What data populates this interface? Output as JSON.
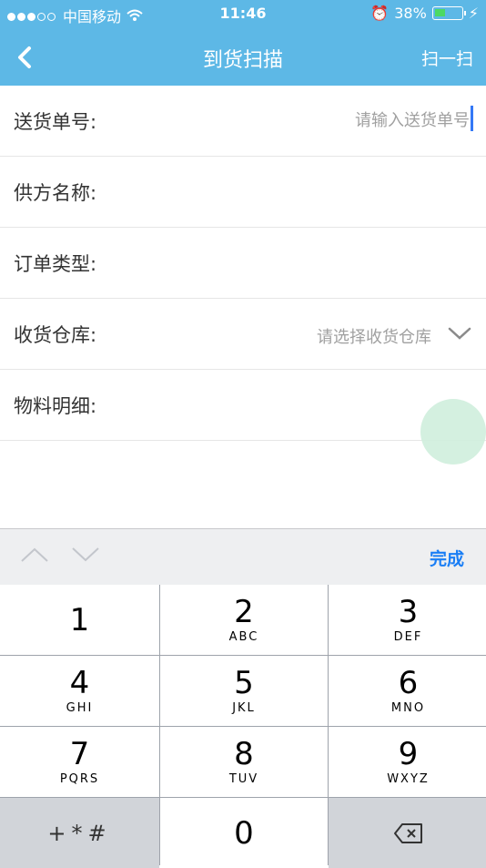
{
  "status_bar": {
    "carrier": "中国移动",
    "time": "11:46",
    "battery": "38%"
  },
  "nav": {
    "title": "到货扫描",
    "action": "扫一扫"
  },
  "form": {
    "delivery_no_label": "送货单号:",
    "delivery_no_placeholder": "请输入送货单号",
    "supplier_label": "供方名称:",
    "order_type_label": "订单类型:",
    "warehouse_label": "收货仓库:",
    "warehouse_placeholder": "请选择收货仓库",
    "material_label": "物料明细:"
  },
  "toolbar": {
    "done": "完成"
  },
  "keypad": {
    "keys": [
      {
        "num": "1",
        "sub": ""
      },
      {
        "num": "2",
        "sub": "ABC"
      },
      {
        "num": "3",
        "sub": "DEF"
      },
      {
        "num": "4",
        "sub": "GHI"
      },
      {
        "num": "5",
        "sub": "JKL"
      },
      {
        "num": "6",
        "sub": "MNO"
      },
      {
        "num": "7",
        "sub": "PQRS"
      },
      {
        "num": "8",
        "sub": "TUV"
      },
      {
        "num": "9",
        "sub": "WXYZ"
      },
      {
        "num": "0",
        "sub": ""
      }
    ],
    "symbols": "+*#"
  }
}
